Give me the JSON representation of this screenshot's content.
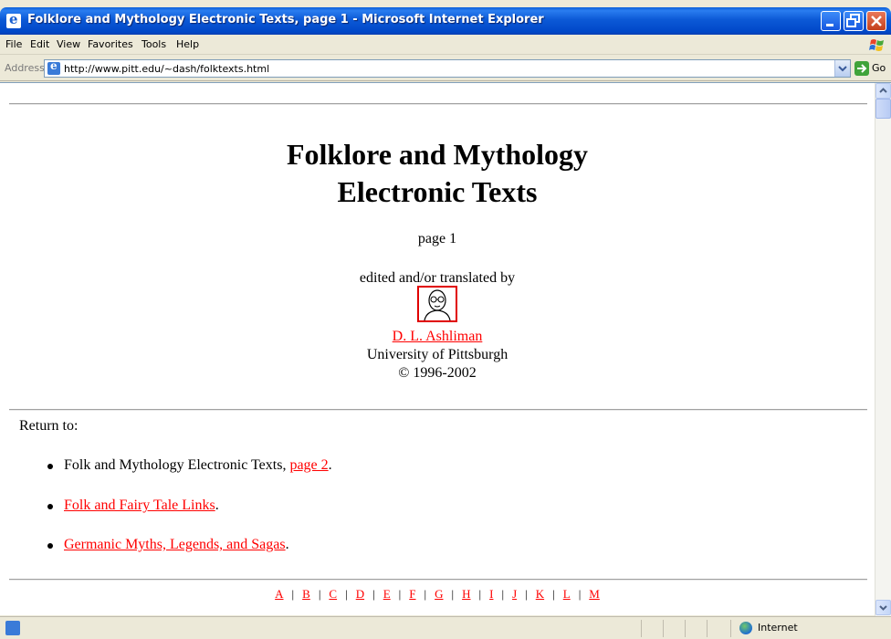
{
  "window": {
    "title": "Folklore and Mythology Electronic Texts, page 1 - Microsoft Internet Explorer"
  },
  "menu": {
    "items": [
      "File",
      "Edit",
      "View",
      "Favorites",
      "Tools",
      "Help"
    ]
  },
  "address": {
    "label": "Address",
    "url": "http://www.pitt.edu/~dash/folktexts.html",
    "go_label": "Go"
  },
  "page": {
    "title_line1": "Folklore and Mythology",
    "title_line2": "Electronic Texts",
    "page_label": "page 1",
    "edited_by": "edited and/or translated by",
    "author_link": "D. L. Ashliman",
    "institution": "University of Pittsburgh",
    "copyright": "© 1996-2002",
    "return_to": "Return to:",
    "links": [
      {
        "prefix": "Folk and Mythology Electronic Texts, ",
        "link": "page 2",
        "suffix": "."
      },
      {
        "prefix": "",
        "link": "Folk and Fairy Tale Links",
        "suffix": "."
      },
      {
        "prefix": "",
        "link": "Germanic Myths, Legends, and Sagas",
        "suffix": "."
      }
    ],
    "alphabet": [
      "A",
      "B",
      "C",
      "D",
      "E",
      "F",
      "G",
      "H",
      "I",
      "J",
      "K",
      "L",
      "M"
    ],
    "link_color": "#ff0000"
  },
  "status": {
    "zone": "Internet"
  }
}
